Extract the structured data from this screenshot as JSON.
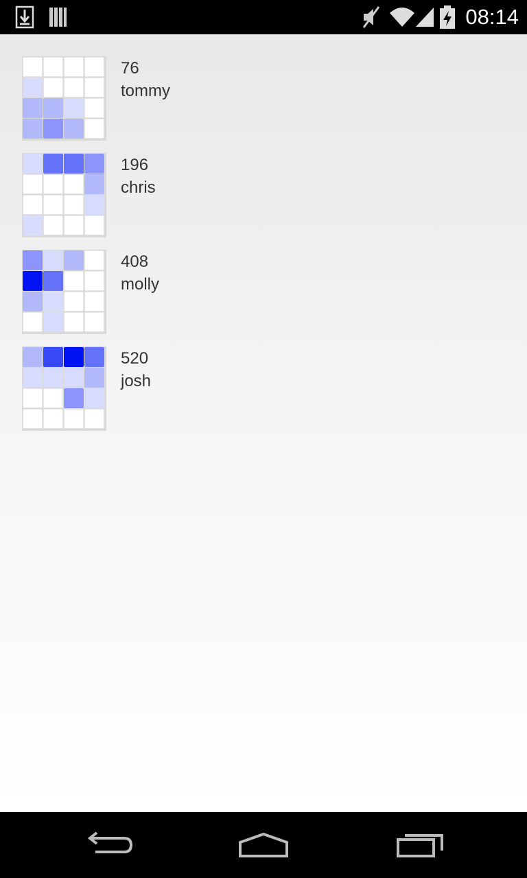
{
  "status_bar": {
    "time": "08:14",
    "icons": [
      "download-icon",
      "storage-icon",
      "mute-icon",
      "wifi-icon",
      "signal-icon",
      "battery-charging-icon"
    ]
  },
  "scores": [
    {
      "score": "76",
      "name": "tommy",
      "tiles": [
        [
          0,
          0,
          0,
          0
        ],
        [
          1,
          0,
          0,
          0
        ],
        [
          2,
          2,
          1,
          0
        ],
        [
          2,
          3,
          2,
          0
        ]
      ]
    },
    {
      "score": "196",
      "name": "chris",
      "tiles": [
        [
          1,
          4,
          4,
          3
        ],
        [
          0,
          0,
          0,
          2
        ],
        [
          0,
          0,
          0,
          1
        ],
        [
          1,
          0,
          0,
          0
        ]
      ]
    },
    {
      "score": "408",
      "name": "molly",
      "tiles": [
        [
          3,
          1,
          2,
          0
        ],
        [
          6,
          4,
          0,
          0
        ],
        [
          2,
          1,
          0,
          0
        ],
        [
          0,
          1,
          0,
          0
        ]
      ]
    },
    {
      "score": "520",
      "name": "josh",
      "tiles": [
        [
          2,
          5,
          6,
          4
        ],
        [
          1,
          1,
          1,
          2
        ],
        [
          0,
          0,
          3,
          1
        ],
        [
          0,
          0,
          0,
          0
        ]
      ]
    }
  ],
  "palette": [
    "#ffffff",
    "#d8dcfc",
    "#b2b9fb",
    "#8b95fa",
    "#6372f8",
    "#3a49f7",
    "#0013f5"
  ],
  "nav": {
    "icons": [
      "back-icon",
      "home-icon",
      "recents-icon"
    ]
  }
}
